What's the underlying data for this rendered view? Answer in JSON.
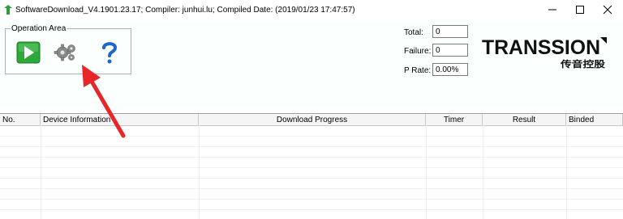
{
  "window": {
    "title": "SoftwareDownload_V4.1901.23.17; Compiler: junhui.lu; Compiled Date: (2019/01/23 17:47:57)",
    "minimize_icon": "minimize-icon",
    "maximize_icon": "maximize-icon",
    "close_icon": "close-icon"
  },
  "operation_area": {
    "legend": "Operation Area",
    "buttons": [
      {
        "icon": "play-icon",
        "color": "#2fa83a"
      },
      {
        "icon": "gear-icon",
        "color": "#8a8a8a"
      },
      {
        "icon": "question-icon",
        "color": "#1e66c8"
      }
    ]
  },
  "stats": {
    "total_label": "Total:",
    "total_value": "0",
    "failure_label": "Failure:",
    "failure_value": "0",
    "prate_label": "P Rate:",
    "prate_value": "0.00%"
  },
  "logo": {
    "text": "TRANSSION",
    "subtext": "传音控股"
  },
  "table": {
    "columns": [
      "No.",
      "Device Information",
      "Download Progress",
      "Timer",
      "Result",
      "Binded"
    ],
    "rows": []
  },
  "colors": {
    "panel_bg": "#fbfffe",
    "annotation_arrow": "#e8262a"
  }
}
